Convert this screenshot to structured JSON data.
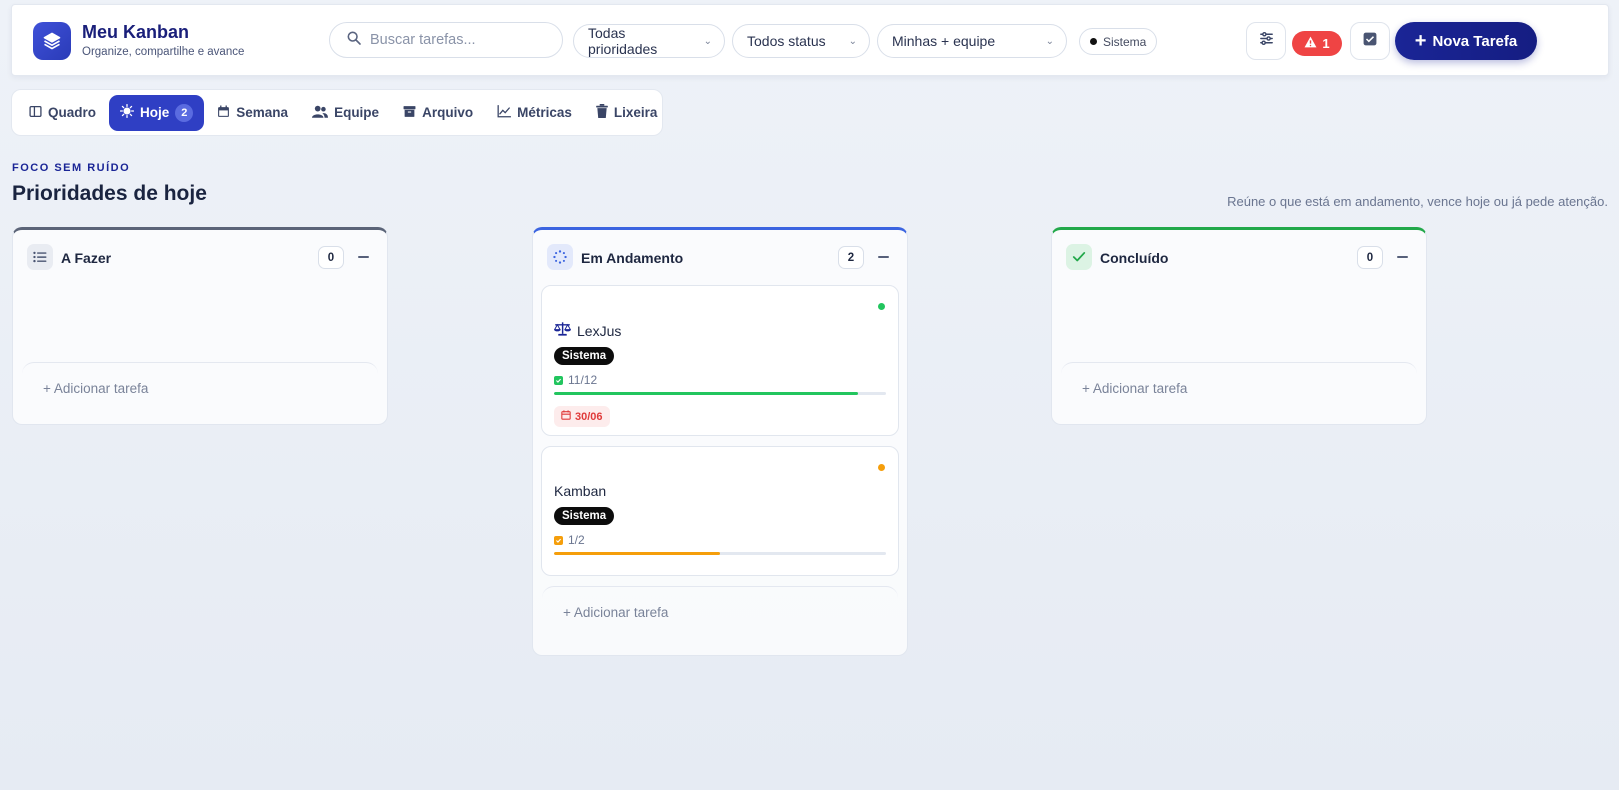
{
  "brand": {
    "title": "Meu Kanban",
    "subtitle": "Organize, compartilhe e avance"
  },
  "search": {
    "placeholder": "Buscar tarefas..."
  },
  "filters": {
    "priority": "Todas prioridades",
    "status": "Todos status",
    "scope": "Minhas + equipe",
    "project_chip": "Sistema"
  },
  "toolbar": {
    "alert_count": "1",
    "new_task_label": "Nova Tarefa"
  },
  "tabs": [
    {
      "label": "Quadro"
    },
    {
      "label": "Hoje",
      "badge": "2"
    },
    {
      "label": "Semana"
    },
    {
      "label": "Equipe"
    },
    {
      "label": "Arquivo"
    },
    {
      "label": "Métricas"
    },
    {
      "label": "Lixeira"
    }
  ],
  "page": {
    "eyebrow": "FOCO SEM RUÍDO",
    "title": "Prioridades de hoje",
    "description": "Reúne o que está em andamento, vence hoje ou já pede atenção."
  },
  "columns": [
    {
      "title": "A Fazer",
      "count": "0",
      "accent": "#5b6478",
      "add_label": "+ Adicionar tarefa"
    },
    {
      "title": "Em Andamento",
      "count": "2",
      "accent": "#3b64e0",
      "add_label": "+ Adicionar tarefa",
      "cards": [
        {
          "title": "LexJus",
          "tag": "Sistema",
          "subtasks": "11/12",
          "progress": 0.917,
          "priority_color": "#22c55e",
          "progress_color": "#22c55e",
          "due": "30/06"
        },
        {
          "title": "Kamban",
          "tag": "Sistema",
          "subtasks": "1/2",
          "progress": 0.5,
          "priority_color": "#f59e0b",
          "progress_color": "#f59e0b"
        }
      ]
    },
    {
      "title": "Concluído",
      "count": "0",
      "accent": "#22a84a",
      "add_label": "+ Adicionar tarefa"
    }
  ]
}
